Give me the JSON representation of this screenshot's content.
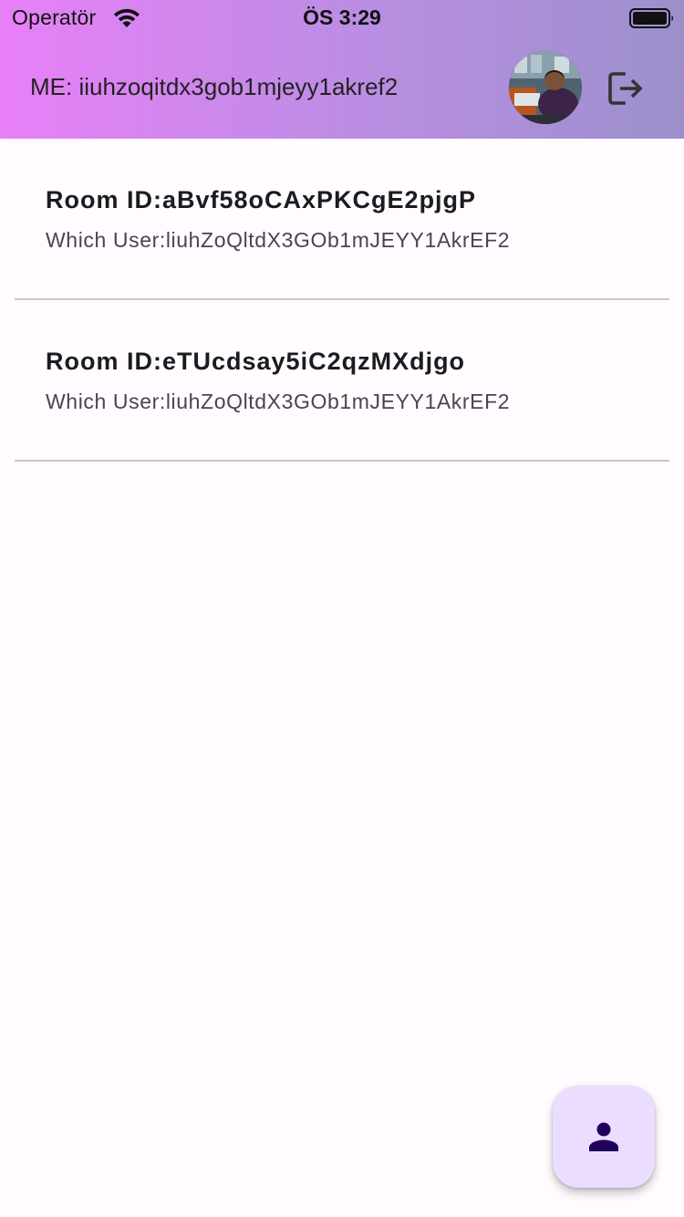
{
  "status_bar": {
    "carrier": "Operatör",
    "time": "ÖS 3:29",
    "icons": [
      "wifi-icon",
      "battery-icon"
    ]
  },
  "app_bar": {
    "title": "ME: iiuhzoqitdx3gob1mjeyy1akref2",
    "avatar_icon": "profile-photo",
    "action_icon": "logout-icon",
    "gradient_colors": [
      "#e880f8",
      "#9c90cc"
    ]
  },
  "rooms": [
    {
      "room_id": "Room ID:aBvf58oCAxPKCgE2pjgP",
      "which_user": "Which User:liuhZoQltdX3GOb1mJEYY1AkrEF2"
    },
    {
      "room_id": "Room ID:eTUcdsay5iC2qzMXdjgo",
      "which_user": "Which User:liuhZoQltdX3GOb1mJEYY1AkrEF2"
    }
  ],
  "fab": {
    "icon": "person-icon",
    "background": "#eaddff",
    "icon_color": "#21005d"
  }
}
